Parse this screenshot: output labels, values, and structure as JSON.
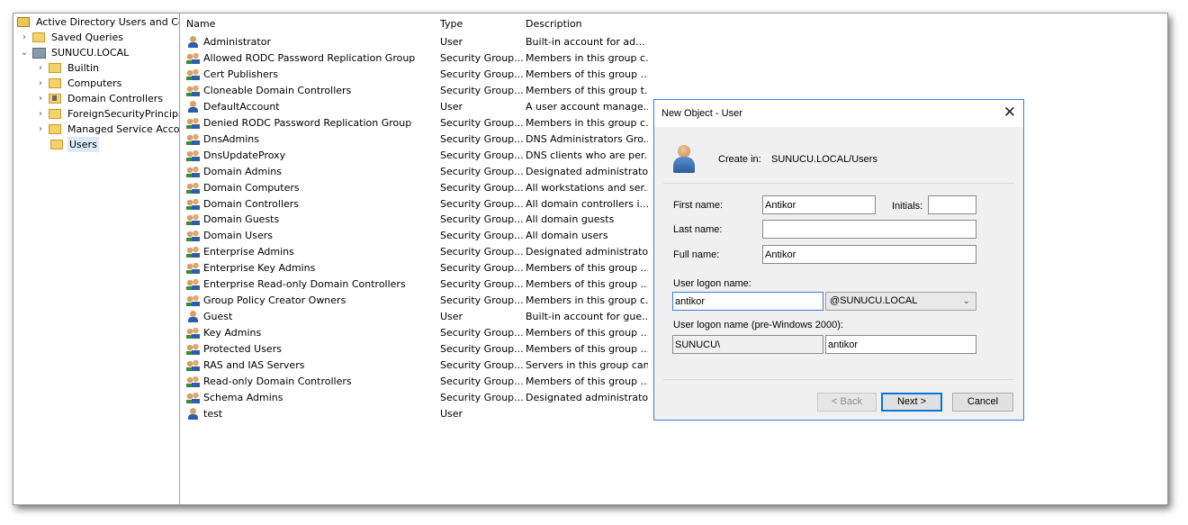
{
  "tree": {
    "root_label": "Active Directory Users and Com",
    "saved_queries": "Saved Queries",
    "domain": "SUNUCU.LOCAL",
    "children": [
      {
        "label": "Builtin",
        "kind": "folder"
      },
      {
        "label": "Computers",
        "kind": "folder"
      },
      {
        "label": "Domain Controllers",
        "kind": "dc"
      },
      {
        "label": "ForeignSecurityPrincipals",
        "kind": "folder"
      },
      {
        "label": "Managed Service Accour",
        "kind": "folder"
      },
      {
        "label": "Users",
        "kind": "folder",
        "selected": true
      }
    ]
  },
  "list": {
    "columns": {
      "name": "Name",
      "type": "Type",
      "description": "Description"
    },
    "rows": [
      {
        "name": "Administrator",
        "type": "User",
        "desc": "Built-in account for ad...",
        "icon": "user"
      },
      {
        "name": "Allowed RODC Password Replication Group",
        "type": "Security Group...",
        "desc": "Members in this group c...",
        "icon": "group"
      },
      {
        "name": "Cert Publishers",
        "type": "Security Group...",
        "desc": "Members of this group ...",
        "icon": "group"
      },
      {
        "name": "Cloneable Domain Controllers",
        "type": "Security Group...",
        "desc": "Members of this group t...",
        "icon": "group"
      },
      {
        "name": "DefaultAccount",
        "type": "User",
        "desc": "A user account manage...",
        "icon": "user"
      },
      {
        "name": "Denied RODC Password Replication Group",
        "type": "Security Group...",
        "desc": "Members in this group c...",
        "icon": "group"
      },
      {
        "name": "DnsAdmins",
        "type": "Security Group...",
        "desc": "DNS Administrators Gro...",
        "icon": "group"
      },
      {
        "name": "DnsUpdateProxy",
        "type": "Security Group...",
        "desc": "DNS clients who are per...",
        "icon": "group"
      },
      {
        "name": "Domain Admins",
        "type": "Security Group...",
        "desc": "Designated administrato...",
        "icon": "group"
      },
      {
        "name": "Domain Computers",
        "type": "Security Group...",
        "desc": "All workstations and ser...",
        "icon": "group"
      },
      {
        "name": "Domain Controllers",
        "type": "Security Group...",
        "desc": "All domain controllers i...",
        "icon": "group"
      },
      {
        "name": "Domain Guests",
        "type": "Security Group...",
        "desc": "All domain guests",
        "icon": "group"
      },
      {
        "name": "Domain Users",
        "type": "Security Group...",
        "desc": "All domain users",
        "icon": "group"
      },
      {
        "name": "Enterprise Admins",
        "type": "Security Group...",
        "desc": "Designated administrato...",
        "icon": "group"
      },
      {
        "name": "Enterprise Key Admins",
        "type": "Security Group...",
        "desc": "Members of this group ...",
        "icon": "group"
      },
      {
        "name": "Enterprise Read-only Domain Controllers",
        "type": "Security Group...",
        "desc": "Members of this group ...",
        "icon": "group"
      },
      {
        "name": "Group Policy Creator Owners",
        "type": "Security Group...",
        "desc": "Members in this group c...",
        "icon": "group"
      },
      {
        "name": "Guest",
        "type": "User",
        "desc": "Built-in account for gue...",
        "icon": "user"
      },
      {
        "name": "Key Admins",
        "type": "Security Group...",
        "desc": "Members of this group ...",
        "icon": "group"
      },
      {
        "name": "Protected Users",
        "type": "Security Group...",
        "desc": "Members of this group ...",
        "icon": "group"
      },
      {
        "name": "RAS and IAS Servers",
        "type": "Security Group...",
        "desc": "Servers in this group can...",
        "icon": "group"
      },
      {
        "name": "Read-only Domain Controllers",
        "type": "Security Group...",
        "desc": "Members of this group ...",
        "icon": "group"
      },
      {
        "name": "Schema Admins",
        "type": "Security Group...",
        "desc": "Designated administrato...",
        "icon": "group"
      },
      {
        "name": "test",
        "type": "User",
        "desc": "",
        "icon": "user"
      }
    ]
  },
  "dialog": {
    "title": "New Object - User",
    "close_glyph": "✕",
    "create_in_label": "Create in:",
    "create_in_value": "SUNUCU.LOCAL/Users",
    "first_name_label": "First name:",
    "first_name_value": "Antikor",
    "initials_label": "Initials:",
    "initials_value": "",
    "last_name_label": "Last name:",
    "last_name_value": "",
    "full_name_label": "Full name:",
    "full_name_value": "Antikor",
    "logon_label": "User logon name:",
    "logon_value": "antikor",
    "domain_suffix": "@SUNUCU.LOCAL",
    "pre2000_label": "User logon name (pre-Windows 2000):",
    "pre2000_domain": "SUNUCU\\",
    "pre2000_value": "antikor",
    "back_label": "< Back",
    "next_label": "Next >",
    "cancel_label": "Cancel"
  }
}
